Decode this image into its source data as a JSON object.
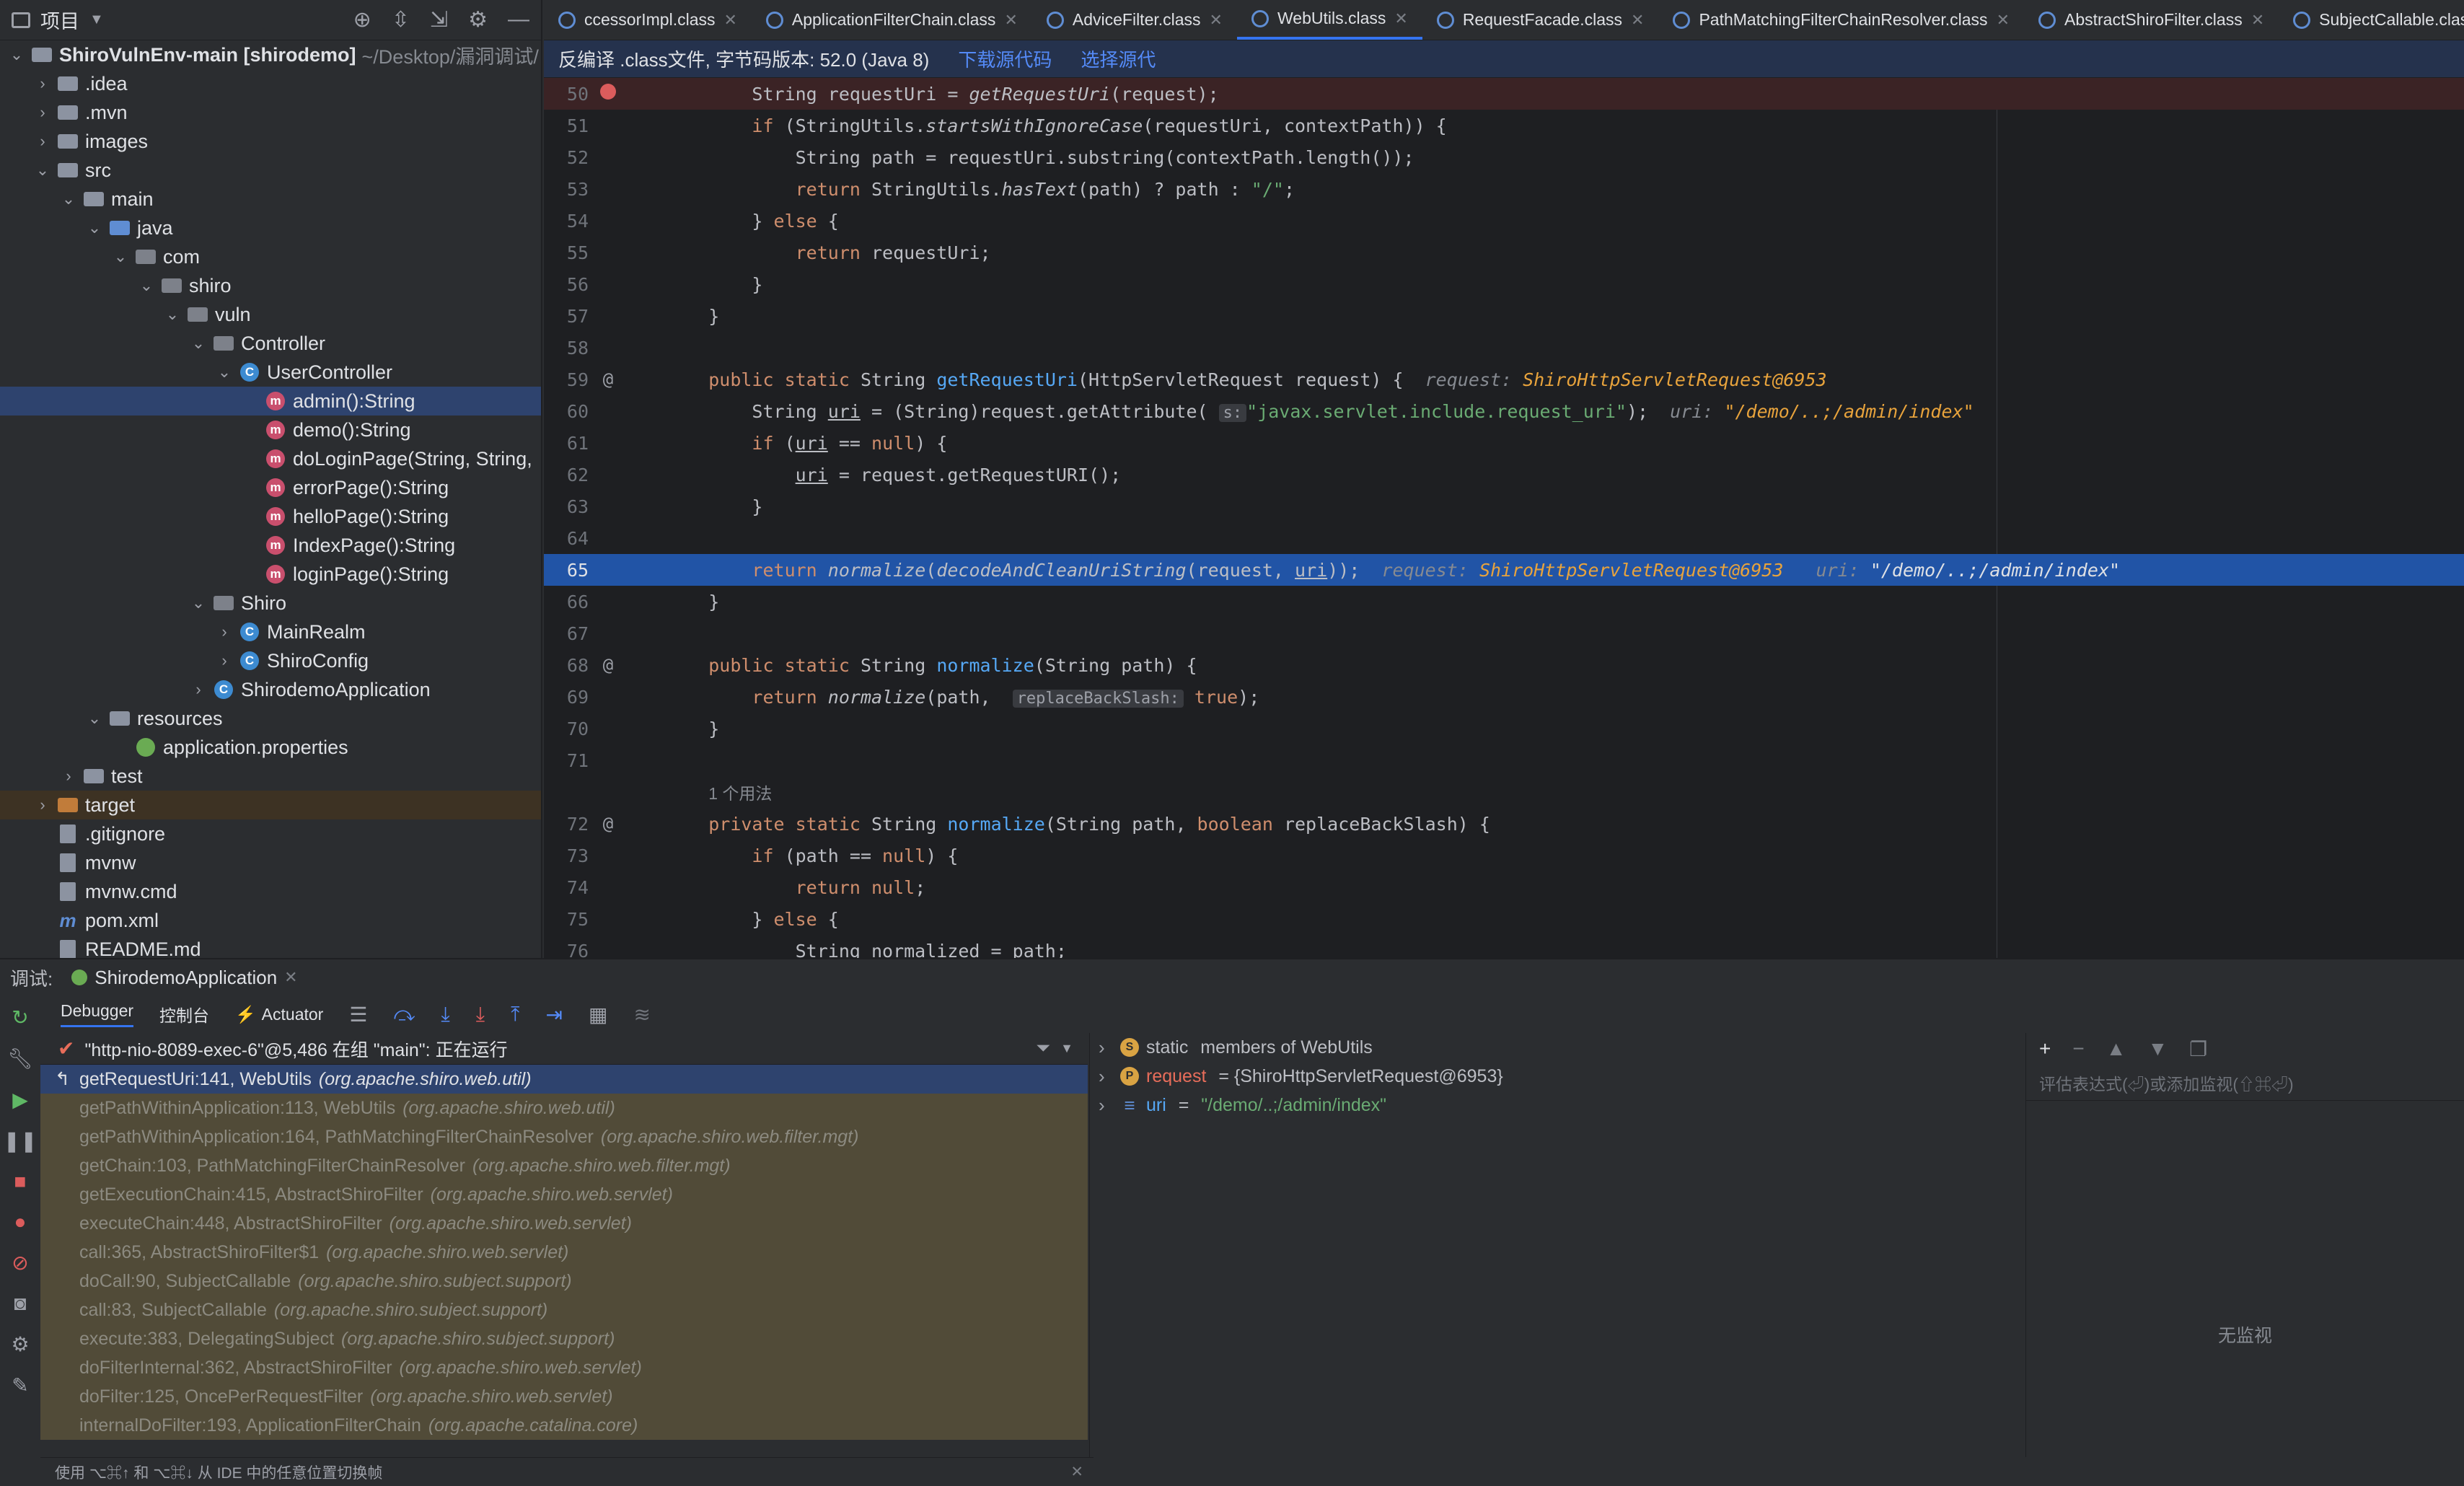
{
  "project_panel": {
    "title": "项目",
    "tree": [
      {
        "label": "ShiroVulnEnv-main [shirodemo]",
        "sub": "~/Desktop/漏洞调试/",
        "type": "folder",
        "level": 0,
        "arrow": "v"
      },
      {
        "label": ".idea",
        "type": "folder",
        "level": 1,
        "arrow": ">"
      },
      {
        "label": ".mvn",
        "type": "folder",
        "level": 1,
        "arrow": ">"
      },
      {
        "label": "images",
        "type": "folder",
        "level": 1,
        "arrow": ">"
      },
      {
        "label": "src",
        "type": "folder",
        "level": 1,
        "arrow": "v"
      },
      {
        "label": "main",
        "type": "folder",
        "level": 2,
        "arrow": "v"
      },
      {
        "label": "java",
        "type": "folder-blue",
        "level": 3,
        "arrow": "v"
      },
      {
        "label": "com",
        "type": "package",
        "level": 4,
        "arrow": "v"
      },
      {
        "label": "shiro",
        "type": "package",
        "level": 5,
        "arrow": "v"
      },
      {
        "label": "vuln",
        "type": "package",
        "level": 6,
        "arrow": "v"
      },
      {
        "label": "Controller",
        "type": "package",
        "level": 7,
        "arrow": "v"
      },
      {
        "label": "UserController",
        "type": "class",
        "level": 8,
        "arrow": "v"
      },
      {
        "label": "admin():String",
        "type": "method",
        "level": 9,
        "arrow": "",
        "selected": true
      },
      {
        "label": "demo():String",
        "type": "method",
        "level": 9,
        "arrow": ""
      },
      {
        "label": "doLoginPage(String, String,",
        "type": "method",
        "level": 9,
        "arrow": ""
      },
      {
        "label": "errorPage():String",
        "type": "method",
        "level": 9,
        "arrow": ""
      },
      {
        "label": "helloPage():String",
        "type": "method",
        "level": 9,
        "arrow": ""
      },
      {
        "label": "IndexPage():String",
        "type": "method",
        "level": 9,
        "arrow": ""
      },
      {
        "label": "loginPage():String",
        "type": "method",
        "level": 9,
        "arrow": ""
      },
      {
        "label": "Shiro",
        "type": "package",
        "level": 7,
        "arrow": "v"
      },
      {
        "label": "MainRealm",
        "type": "class",
        "level": 8,
        "arrow": ">"
      },
      {
        "label": "ShiroConfig",
        "type": "class",
        "level": 8,
        "arrow": ">"
      },
      {
        "label": "ShirodemoApplication",
        "type": "class",
        "level": 7,
        "arrow": ">"
      },
      {
        "label": "resources",
        "type": "folder",
        "level": 3,
        "arrow": "v"
      },
      {
        "label": "application.properties",
        "type": "spring",
        "level": 4,
        "arrow": ""
      },
      {
        "label": "test",
        "type": "folder",
        "level": 2,
        "arrow": ">"
      },
      {
        "label": "target",
        "type": "folder-orange",
        "level": 1,
        "arrow": ">",
        "target": true
      },
      {
        "label": ".gitignore",
        "type": "file",
        "level": 1,
        "arrow": ""
      },
      {
        "label": "mvnw",
        "type": "file",
        "level": 1,
        "arrow": ""
      },
      {
        "label": "mvnw.cmd",
        "type": "file",
        "level": 1,
        "arrow": ""
      },
      {
        "label": "pom.xml",
        "type": "maven",
        "level": 1,
        "arrow": ""
      },
      {
        "label": "README.md",
        "type": "file",
        "level": 1,
        "arrow": ""
      }
    ]
  },
  "tabs": [
    {
      "label": "ccessorImpl.class",
      "active": false
    },
    {
      "label": "ApplicationFilterChain.class",
      "active": false
    },
    {
      "label": "AdviceFilter.class",
      "active": false
    },
    {
      "label": "WebUtils.class",
      "active": true
    },
    {
      "label": "RequestFacade.class",
      "active": false
    },
    {
      "label": "PathMatchingFilterChainResolver.class",
      "active": false
    },
    {
      "label": "AbstractShiroFilter.class",
      "active": false
    },
    {
      "label": "SubjectCallable.class",
      "active": false
    }
  ],
  "banner": {
    "text": "反编译 .class文件, 字节码版本: 52.0 (Java 8)",
    "download": "下载源代码",
    "choose": "选择源代"
  },
  "editor": {
    "usage_label": "1 个用法",
    "hints": {
      "request_label": "request:",
      "request_value": "ShiroHttpServletRequest@6953",
      "uri_label": "uri:",
      "uri_value": "\"/demo/..;/admin/index\"",
      "s_label": "s:",
      "replace_label": "replaceBackSlash:"
    }
  },
  "debugger": {
    "title": "调试:",
    "run_config": "ShirodemoApplication",
    "tabs": [
      "Debugger",
      "控制台",
      "Actuator"
    ],
    "thread": "\"http-nio-8089-exec-6\"@5,486 在组 \"main\": 正在运行",
    "frames": [
      {
        "method": "getRequestUri:141, WebUtils",
        "pkg": "(org.apache.shiro.web.util)",
        "current": true
      },
      {
        "method": "getPathWithinApplication:113, WebUtils",
        "pkg": "(org.apache.shiro.web.util)"
      },
      {
        "method": "getPathWithinApplication:164, PathMatchingFilterChainResolver",
        "pkg": "(org.apache.shiro.web.filter.mgt)"
      },
      {
        "method": "getChain:103, PathMatchingFilterChainResolver",
        "pkg": "(org.apache.shiro.web.filter.mgt)"
      },
      {
        "method": "getExecutionChain:415, AbstractShiroFilter",
        "pkg": "(org.apache.shiro.web.servlet)"
      },
      {
        "method": "executeChain:448, AbstractShiroFilter",
        "pkg": "(org.apache.shiro.web.servlet)"
      },
      {
        "method": "call:365, AbstractShiroFilter$1",
        "pkg": "(org.apache.shiro.web.servlet)"
      },
      {
        "method": "doCall:90, SubjectCallable",
        "pkg": "(org.apache.shiro.subject.support)"
      },
      {
        "method": "call:83, SubjectCallable",
        "pkg": "(org.apache.shiro.subject.support)"
      },
      {
        "method": "execute:383, DelegatingSubject",
        "pkg": "(org.apache.shiro.subject.support)"
      },
      {
        "method": "doFilterInternal:362, AbstractShiroFilter",
        "pkg": "(org.apache.shiro.web.servlet)"
      },
      {
        "method": "doFilter:125, OncePerRequestFilter",
        "pkg": "(org.apache.shiro.web.servlet)"
      },
      {
        "method": "internalDoFilter:193, ApplicationFilterChain",
        "pkg": "(org.apache.catalina.core)"
      }
    ],
    "variables": [
      {
        "badge": "S",
        "name": "static",
        "rest": " members of WebUtils",
        "str": ""
      },
      {
        "badge": "P",
        "name": "request",
        "rest": " = {ShiroHttpServletRequest@6953}",
        "str": ""
      },
      {
        "badge": "",
        "name": "uri",
        "rest": " = ",
        "str": "\"/demo/..;/admin/index\""
      }
    ],
    "watch_placeholder": "评估表达式(⏎)或添加监视(⇧⌘⏎)",
    "watch_empty": "无监视",
    "status": "使用 ⌥⌘↑ 和 ⌥⌘↓ 从 IDE 中的任意位置切换帧"
  }
}
